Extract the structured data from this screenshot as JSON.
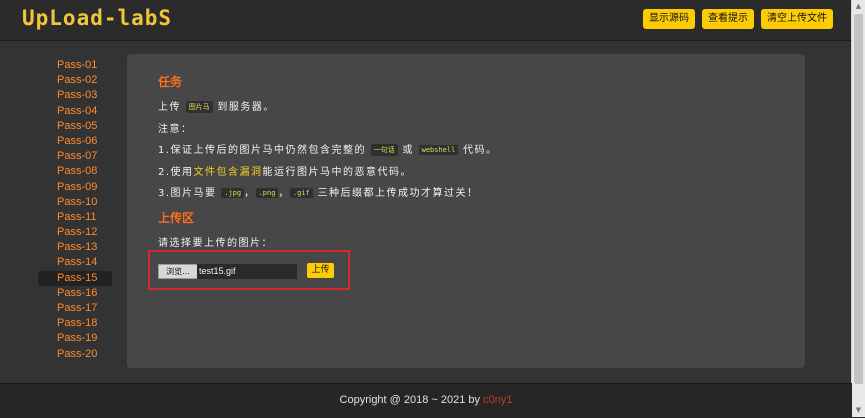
{
  "header": {
    "logo": "UpLoad-labS",
    "buttons": [
      "显示源码",
      "查看提示",
      "清空上传文件"
    ]
  },
  "sidebar": {
    "items": [
      "Pass-01",
      "Pass-02",
      "Pass-03",
      "Pass-04",
      "Pass-05",
      "Pass-06",
      "Pass-07",
      "Pass-08",
      "Pass-09",
      "Pass-10",
      "Pass-11",
      "Pass-12",
      "Pass-13",
      "Pass-14",
      "Pass-15",
      "Pass-16",
      "Pass-17",
      "Pass-18",
      "Pass-19",
      "Pass-20"
    ],
    "active_index": 14
  },
  "task": {
    "title": "任务",
    "line1_pre": "上传",
    "line1_code": "图片马",
    "line1_post": "到服务器。",
    "note": "注意：",
    "item1_pre": "1.保证上传后的图片马中仍然包含完整的",
    "item1_code1": "一句话",
    "item1_mid": "或",
    "item1_code2": "webshell",
    "item1_post": "代码。",
    "item2_pre": "2.使用",
    "item2_hl": "文件包含漏洞",
    "item2_post": "能运行图片马中的恶意代码。",
    "item3_pre": "3.图片马要",
    "item3_code1": ".jpg",
    "item3_sep1": "，",
    "item3_code2": ".png",
    "item3_sep2": "，",
    "item3_code3": ".gif",
    "item3_post": "三种后缀都上传成功才算过关！"
  },
  "upload": {
    "title": "上传区",
    "prompt": "请选择要上传的图片：",
    "browse_label": "浏览...",
    "file_value": "test15.gif",
    "submit_label": "上传"
  },
  "footer": {
    "text": "Copyright @ 2018 ~ 2021 by ",
    "author": "c0ny1"
  },
  "colors": {
    "accent": "#ffcc00",
    "sidebar_link": "#ff8a2b",
    "section_title": "#ff6d1f",
    "highlight_box": "#d02a2a"
  }
}
